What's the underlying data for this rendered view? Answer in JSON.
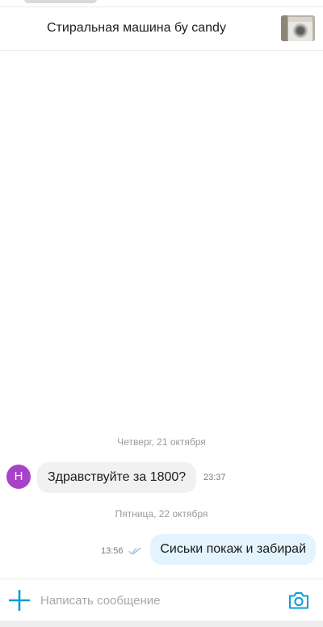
{
  "header": {
    "title": "Стиральная машина бу candy",
    "thumbnail_icon": "washing-machine-photo"
  },
  "chat": {
    "separators": [
      "Четверг, 21 октября",
      "Пятница, 22 октября"
    ],
    "incoming": {
      "avatar_letter": "Н",
      "avatar_color": "#a843c9",
      "text": "Здравствуйте за 1800?",
      "time": "23:37"
    },
    "outgoing": {
      "text": "Сиськи покаж и забирай",
      "time": "13:56",
      "status_icon": "double-check-icon"
    }
  },
  "composer": {
    "placeholder": "Написать сообщение",
    "attach_icon": "plus-icon",
    "camera_icon": "camera-icon"
  },
  "colors": {
    "accent": "#0a9ed9",
    "outgoing_bubble": "#e4f4fe",
    "incoming_bubble": "#f1f1f1"
  }
}
